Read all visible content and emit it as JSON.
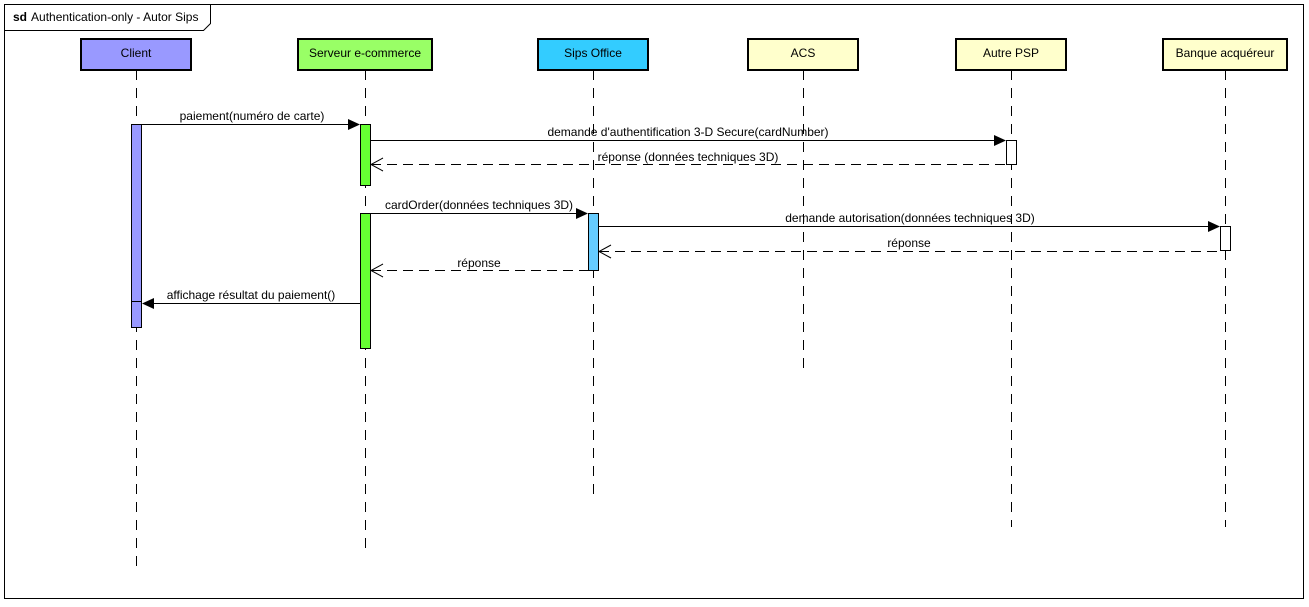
{
  "frame": {
    "keyword": "sd",
    "title": "Authentication-only - Autor Sips"
  },
  "lifelines": [
    {
      "id": "client",
      "label": "Client",
      "color": "#9999ff",
      "bar_color": "#9999ff"
    },
    {
      "id": "serveur",
      "label": "Serveur e-commerce",
      "color": "#99ff66",
      "bar_color": "#66ff33"
    },
    {
      "id": "sips",
      "label": "Sips Office",
      "color": "#33ccff",
      "bar_color": "#66ccff"
    },
    {
      "id": "acs",
      "label": "ACS",
      "color": "#ffffcc",
      "bar_color": "#ffffff"
    },
    {
      "id": "psp",
      "label": "Autre PSP",
      "color": "#ffffcc",
      "bar_color": "#ffffff"
    },
    {
      "id": "banque",
      "label": "Banque acquéreur",
      "color": "#ffffcc",
      "bar_color": "#ffffff"
    }
  ],
  "messages": [
    {
      "from": "client",
      "to": "serveur",
      "label": "paiement(numéro de carte)",
      "type": "sync"
    },
    {
      "from": "serveur",
      "to": "psp",
      "label": "demande d'authentification 3-D Secure(cardNumber)",
      "type": "sync"
    },
    {
      "from": "psp",
      "to": "serveur",
      "label": "réponse (données techniques 3D)",
      "type": "reply"
    },
    {
      "from": "serveur",
      "to": "sips",
      "label": "cardOrder(données techniques 3D)",
      "type": "sync"
    },
    {
      "from": "sips",
      "to": "banque",
      "label": "demande autorisation(données techniques 3D)",
      "type": "sync"
    },
    {
      "from": "banque",
      "to": "sips",
      "label": "réponse",
      "type": "reply"
    },
    {
      "from": "sips",
      "to": "serveur",
      "label": "réponse",
      "type": "reply"
    },
    {
      "from": "serveur",
      "to": "client",
      "label": "affichage résultat du paiement()",
      "type": "sync"
    }
  ]
}
